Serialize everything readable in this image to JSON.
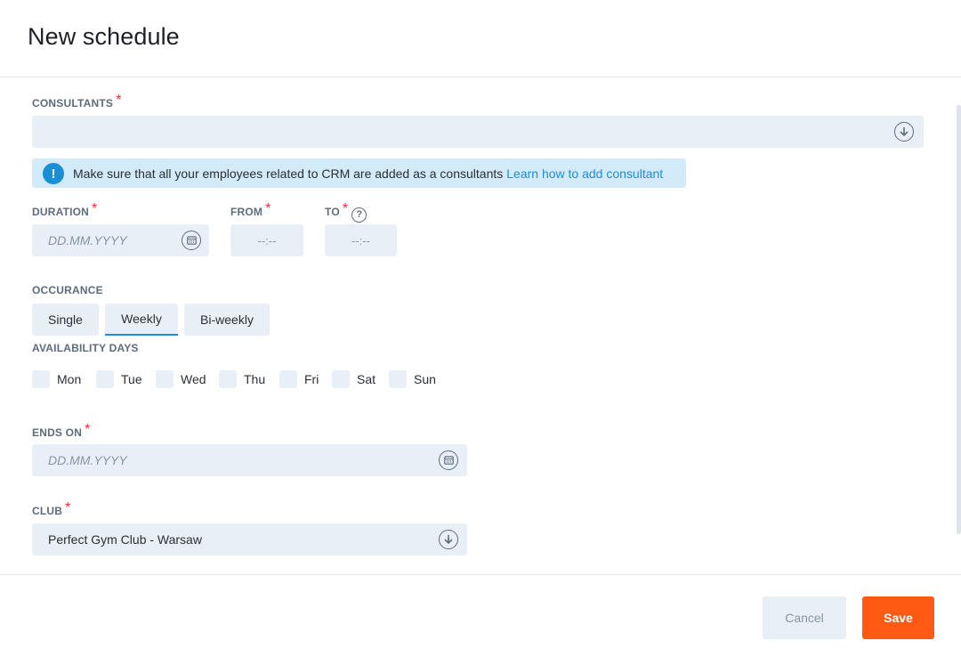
{
  "dialog": {
    "title": "New schedule"
  },
  "consultants": {
    "label": "CONSULTANTS",
    "required_mark": "*",
    "value": ""
  },
  "info": {
    "text": "Make sure that all your employees related to CRM are added as a consultants",
    "link": "Learn how to add consultant",
    "icon": "exclamation-icon",
    "color": "#1b8fd6"
  },
  "duration": {
    "label": "DURATION",
    "required_mark": "*",
    "placeholder": "DD.MM.YYYY"
  },
  "from": {
    "label": "FROM",
    "required_mark": "*",
    "placeholder": "--:--"
  },
  "to": {
    "label": "TO",
    "required_mark": "*",
    "placeholder": "--:--",
    "help": "?"
  },
  "occurrence": {
    "label": "OCCURANCE",
    "options": [
      "Single",
      "Weekly",
      "Bi-weekly"
    ],
    "selected": "Weekly"
  },
  "availability": {
    "label": "AVAILABILITY DAYS",
    "days": [
      "Mon",
      "Tue",
      "Wed",
      "Thu",
      "Fri",
      "Sat",
      "Sun"
    ]
  },
  "ends_on": {
    "label": "ENDS ON",
    "required_mark": "*",
    "placeholder": "DD.MM.YYYY"
  },
  "club": {
    "label": "CLUB",
    "required_mark": "*",
    "value": "Perfect Gym Club - Warsaw"
  },
  "footer": {
    "cancel_label": "Cancel",
    "save_label": "Save"
  },
  "colors": {
    "accent": "#ff5a14",
    "link": "#1b8fd6",
    "required": "#e5322d",
    "field_bg": "#e8eff6"
  }
}
